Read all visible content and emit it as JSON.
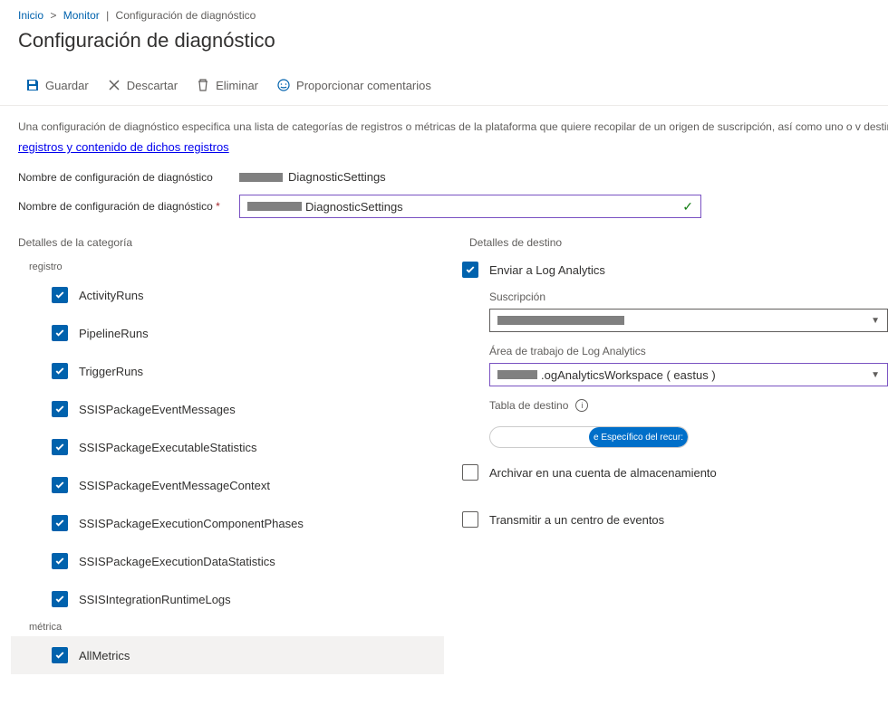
{
  "breadcrumb": {
    "home": "Inicio",
    "monitor": "Monitor",
    "current": "Configuración de diagnóstico"
  },
  "page_title": "Configuración de diagnóstico",
  "toolbar": {
    "save": "Guardar",
    "discard": "Descartar",
    "delete": "Eliminar",
    "feedback": "Proporcionar comentarios"
  },
  "description": "Una configuración de diagnóstico especifica una lista de categorías de registros o métricas de la plataforma que quiere recopilar de un origen de suscripción, así como uno o v destinos a los que puede transmitir contenido. Se cobrarán los cargos de uso normales para el destino. Más información sobre las diferentes categorías de",
  "description_link": "registros y contenido de dichos registros",
  "name_field": {
    "label": "Nombre de configuración de diagnóstico",
    "label_required": "Nombre de configuración de diagnóstico",
    "static_suffix": "DiagnosticSettings",
    "input_suffix": "DiagnosticSettings"
  },
  "left": {
    "title": "Detalles de la categoría",
    "logs_label": "registro",
    "metrics_label": "métrica",
    "logs": [
      "ActivityRuns",
      "PipelineRuns",
      "TriggerRuns",
      "SSISPackageEventMessages",
      "SSISPackageExecutableStatistics",
      "SSISPackageEventMessageContext",
      "SSISPackageExecutionComponentPhases",
      "SSISPackageExecutionDataStatistics",
      "SSISIntegrationRuntimeLogs"
    ],
    "metrics": [
      "AllMetrics"
    ]
  },
  "right": {
    "title": "Detalles de destino",
    "send_la": "Enviar a Log Analytics",
    "subscription_label": "Suscripción",
    "workspace_label": "Área de trabajo de Log Analytics",
    "workspace_value_suffix": ".ogAnalyticsWorkspace ( eastus )",
    "dest_table_label": "Tabla de destino",
    "toggle_active": "e Específico del recur:",
    "archive": "Archivar en una cuenta de almacenamiento",
    "eventhub": "Transmitir a un centro de eventos"
  }
}
